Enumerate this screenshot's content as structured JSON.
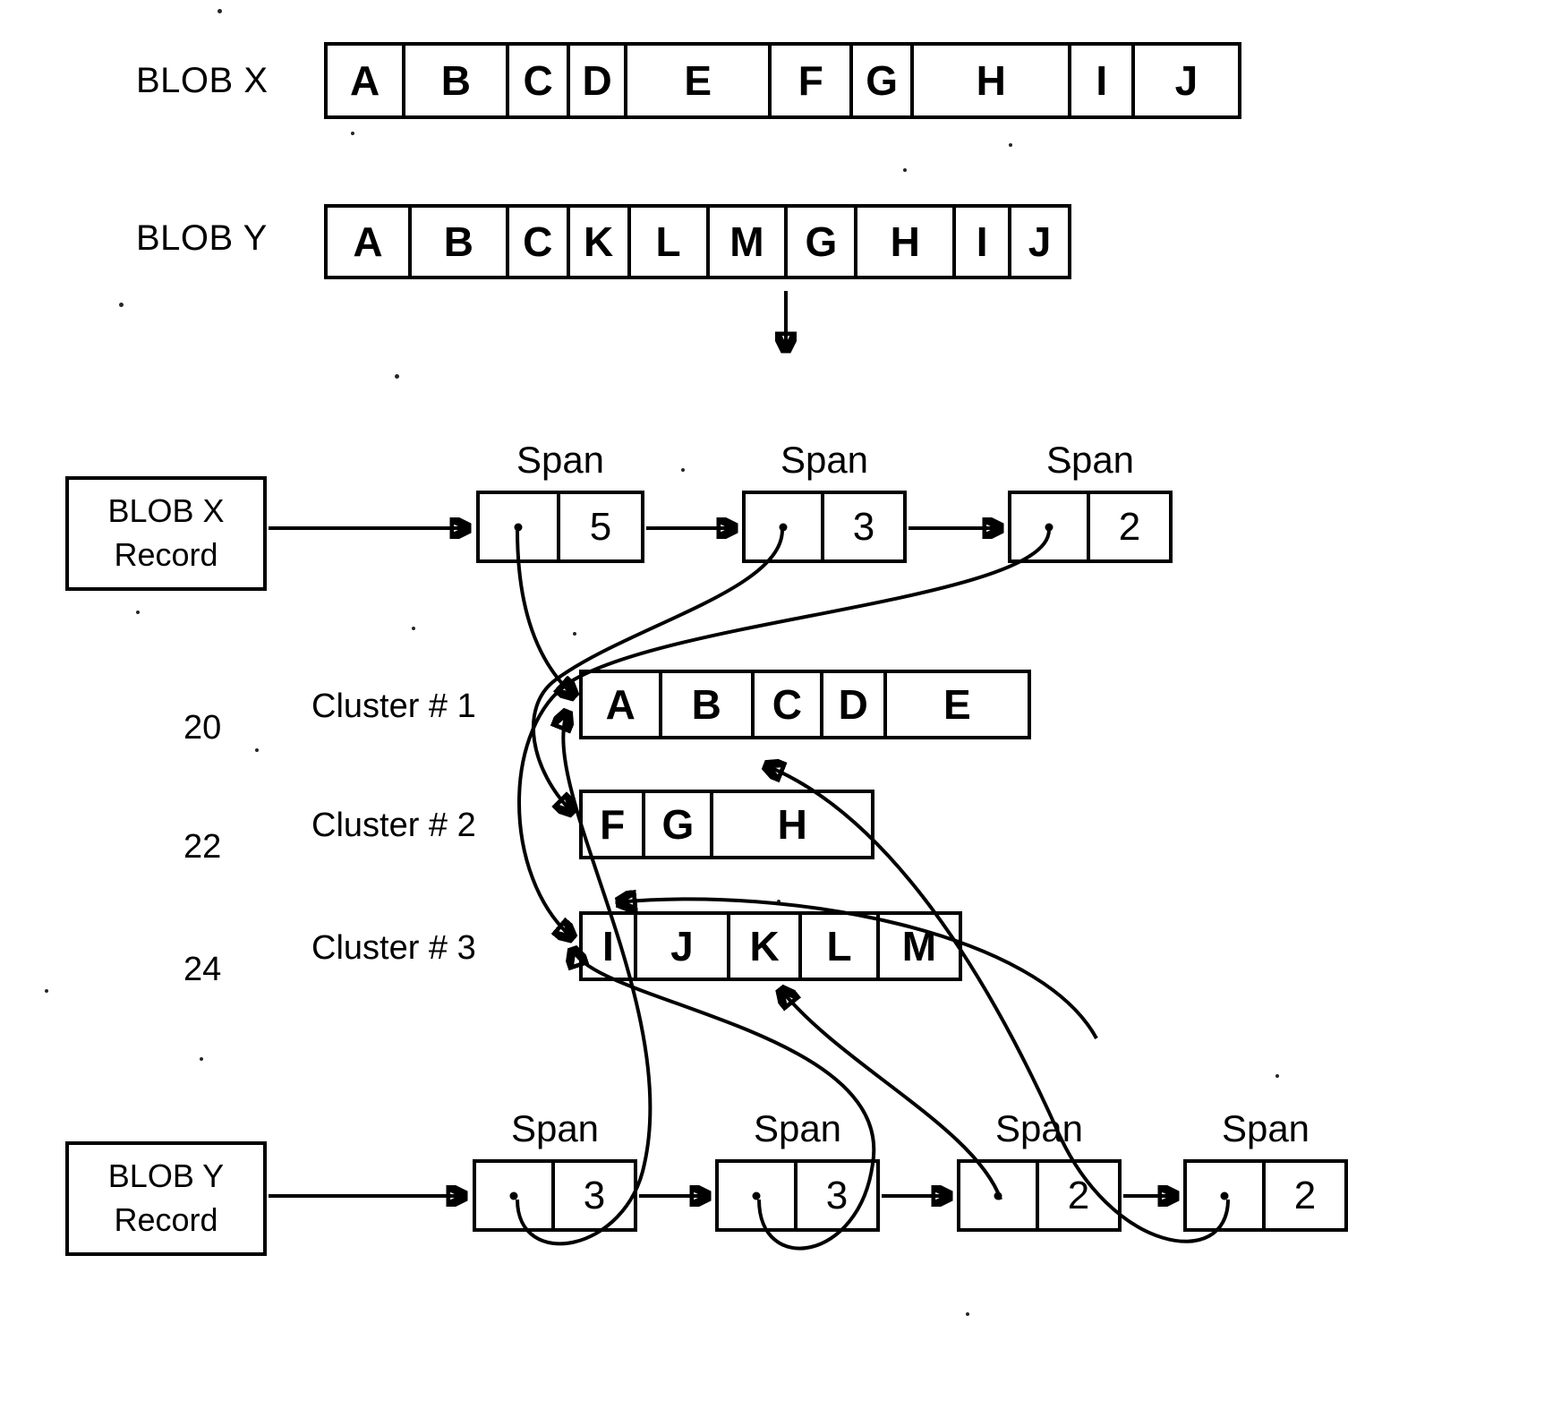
{
  "figure": {
    "title_rows": [
      {
        "label": "BLOB X",
        "cells": [
          "A",
          "B",
          "C",
          "D",
          "E",
          "F",
          "G",
          "H",
          "I",
          "J"
        ]
      },
      {
        "label": "BLOB Y",
        "cells": [
          "A",
          "B",
          "C",
          "K",
          "L",
          "M",
          "G",
          "H",
          "I",
          "J"
        ]
      }
    ],
    "records": {
      "x": {
        "line1": "BLOB X",
        "line2": "Record"
      },
      "y": {
        "line1": "BLOB Y",
        "line2": "Record"
      }
    },
    "span_label": "Span",
    "x_spans": [
      {
        "label": "Span",
        "count": "5"
      },
      {
        "label": "Span",
        "count": "3"
      },
      {
        "label": "Span",
        "count": "2"
      }
    ],
    "y_spans": [
      {
        "label": "Span",
        "count": "3"
      },
      {
        "label": "Span",
        "count": "3"
      },
      {
        "label": "Span",
        "count": "2"
      },
      {
        "label": "Span",
        "count": "2"
      }
    ],
    "clusters": [
      {
        "ref": "20",
        "label": "Cluster # 1",
        "cells": [
          "A",
          "B",
          "C",
          "D",
          "E"
        ]
      },
      {
        "ref": "22",
        "label": "Cluster # 2",
        "cells": [
          "F",
          "G",
          "H"
        ]
      },
      {
        "ref": "24",
        "label": "Cluster # 3",
        "cells": [
          "I",
          "J",
          "K",
          "L",
          "M"
        ]
      }
    ]
  },
  "colors": {
    "ink": "#000000",
    "paper": "#ffffff"
  }
}
